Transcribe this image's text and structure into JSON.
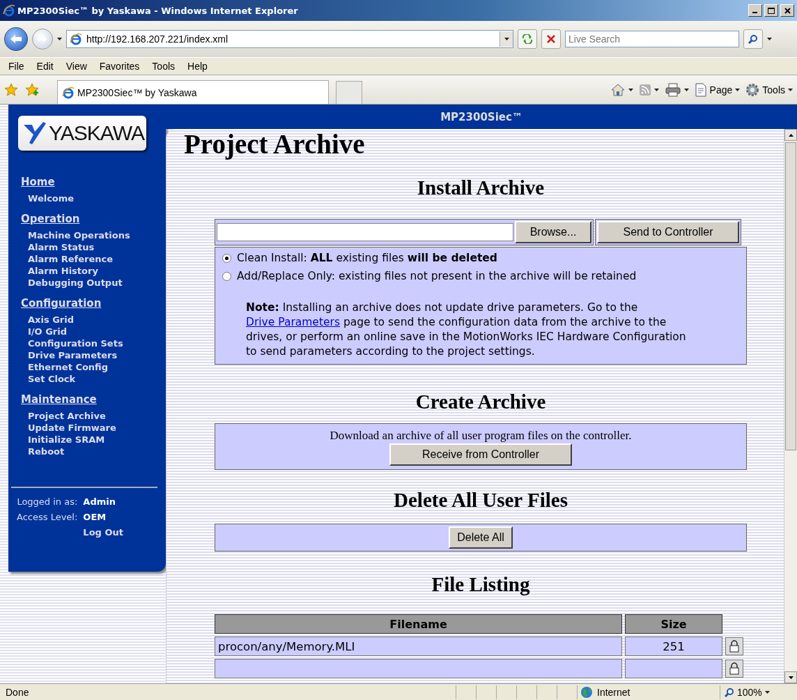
{
  "window": {
    "title": "MP2300Siec™ by Yaskawa - Windows Internet Explorer"
  },
  "browser": {
    "address": "http://192.168.207.221/index.xml",
    "search_placeholder": "Live Search",
    "menu": [
      "File",
      "Edit",
      "View",
      "Favorites",
      "Tools",
      "Help"
    ],
    "tab_title": "MP2300Siec™ by Yaskawa",
    "command_bar": [
      {
        "kind": "home"
      },
      {
        "kind": "feeds"
      },
      {
        "kind": "print"
      },
      {
        "kind": "page",
        "label": "Page"
      },
      {
        "kind": "tools",
        "label": "Tools"
      }
    ]
  },
  "page": {
    "banner": "MP2300Siec™",
    "logo": "YASKAWA",
    "sidebar": {
      "sections": [
        {
          "heading": "Home",
          "items": [
            "Welcome"
          ]
        },
        {
          "heading": "Operation",
          "items": [
            "Machine Operations",
            "Alarm Status",
            "Alarm Reference",
            "Alarm History",
            "Debugging Output"
          ]
        },
        {
          "heading": "Configuration",
          "items": [
            "Axis Grid",
            "I/O Grid",
            "Configuration Sets",
            "Drive Parameters",
            "Ethernet Config",
            "Set Clock"
          ]
        },
        {
          "heading": "Maintenance",
          "items": [
            "Project Archive",
            "Update Firmware",
            "Initialize SRAM",
            "Reboot"
          ]
        }
      ],
      "login": [
        {
          "label": "Logged in as:",
          "value": "Admin"
        },
        {
          "label": "Access Level:",
          "value": "OEM"
        }
      ],
      "logout": "Log Out"
    },
    "title": "Project Archive",
    "install": {
      "heading": "Install Archive",
      "browse": "Browse...",
      "send": "Send to Controller",
      "options": [
        {
          "label": "Clean Install: **ALL** existing files **will be deleted**",
          "selected": true
        },
        {
          "label": "Add/Replace Only: existing files not present in the archive will be retained",
          "selected": false
        }
      ],
      "note": {
        "before": "**Note:** Installing an archive does not update drive parameters. Go to the",
        "link": "Drive Parameters",
        "after": "page to send the configuration data from the archive to the drives, or perform an online save in the MotionWorks IEC Hardware Configuration to send parameters according to the project settings."
      }
    },
    "create": {
      "heading": "Create Archive",
      "text": "Download an archive of all user program files on the controller.",
      "button": "Receive from Controller"
    },
    "delete": {
      "heading": "Delete All User Files",
      "button": "Delete All"
    },
    "listing": {
      "heading": "File Listing",
      "columns": [
        "Filename",
        "Size"
      ],
      "rows": [
        {
          "filename": "procon/any/Memory.MLI",
          "size": "251"
        }
      ]
    }
  },
  "status": {
    "text": "Done",
    "zone": "Internet",
    "zoom": "100%"
  }
}
